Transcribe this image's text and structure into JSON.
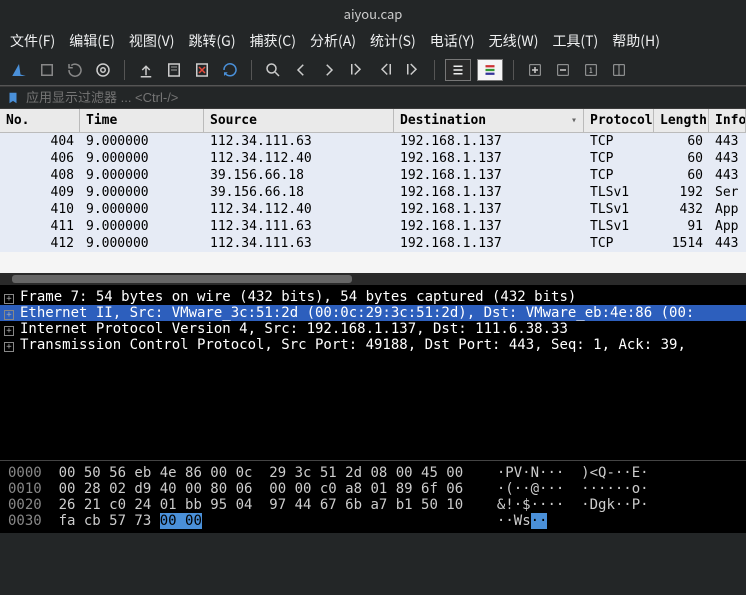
{
  "window": {
    "title": "aiyou.cap"
  },
  "menu": {
    "file": "文件(F)",
    "edit": "编辑(E)",
    "view": "视图(V)",
    "jump": "跳转(G)",
    "capture": "捕获(C)",
    "analyze": "分析(A)",
    "stats": "统计(S)",
    "telephony": "电话(Y)",
    "wireless": "无线(W)",
    "tools": "工具(T)",
    "help": "帮助(H)"
  },
  "filter": {
    "placeholder": "应用显示过滤器 ... <Ctrl-/>"
  },
  "columns": {
    "no": "No.",
    "time": "Time",
    "source": "Source",
    "destination": "Destination",
    "protocol": "Protocol",
    "length": "Length",
    "info": "Info"
  },
  "packets": [
    {
      "no": "404",
      "t": "9.000000",
      "s": "112.34.111.63",
      "d": "192.168.1.137",
      "p": "TCP",
      "l": "60",
      "i": "443"
    },
    {
      "no": "406",
      "t": "9.000000",
      "s": "112.34.112.40",
      "d": "192.168.1.137",
      "p": "TCP",
      "l": "60",
      "i": "443"
    },
    {
      "no": "408",
      "t": "9.000000",
      "s": "39.156.66.18",
      "d": "192.168.1.137",
      "p": "TCP",
      "l": "60",
      "i": "443"
    },
    {
      "no": "409",
      "t": "9.000000",
      "s": "39.156.66.18",
      "d": "192.168.1.137",
      "p": "TLSv1",
      "l": "192",
      "i": "Ser"
    },
    {
      "no": "410",
      "t": "9.000000",
      "s": "112.34.112.40",
      "d": "192.168.1.137",
      "p": "TLSv1",
      "l": "432",
      "i": "App"
    },
    {
      "no": "411",
      "t": "9.000000",
      "s": "112.34.111.63",
      "d": "192.168.1.137",
      "p": "TLSv1",
      "l": "91",
      "i": "App"
    },
    {
      "no": "412",
      "t": "9.000000",
      "s": "112.34.111.63",
      "d": "192.168.1.137",
      "p": "TCP",
      "l": "1514",
      "i": "443"
    }
  ],
  "details": {
    "l0": "Frame 7: 54 bytes on wire (432 bits), 54 bytes captured (432 bits)",
    "l1sel": "Ethernet II, Src: VMware_3c:51:2d (00:0c:29:3c:51:2d), Dst: VMware_eb:4e:86 (00:",
    "l2": "Internet Protocol Version 4, Src: 192.168.1.137, Dst: 111.6.38.33",
    "l3": "Transmission Control Protocol, Src Port: 49188, Dst Port: 443, Seq: 1, Ack: 39,"
  },
  "hex": {
    "r0": {
      "off": "0000",
      "b": "00 50 56 eb 4e 86 00 0c  29 3c 51 2d 08 00 45 00",
      "a": "·PV·N···  )<Q-··E·"
    },
    "r1": {
      "off": "0010",
      "b": "00 28 02 d9 40 00 80 06  00 00 c0 a8 01 89 6f 06",
      "a": "·(··@···  ······o·"
    },
    "r2": {
      "off": "0020",
      "b": "26 21 c0 24 01 bb 95 04  97 44 67 6b a7 b1 50 10",
      "a": "&!·$····  ·Dgk··P·"
    },
    "r3": {
      "off": "0030",
      "b1": "fa cb 57 73 ",
      "b2": "00 00",
      "a": "··Ws",
      "a2": "··"
    }
  }
}
